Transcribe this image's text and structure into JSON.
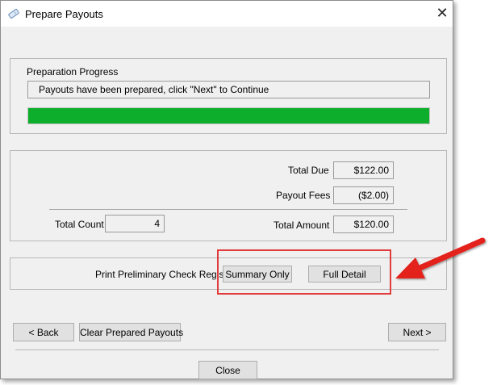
{
  "window": {
    "title": "Prepare Payouts",
    "app_icon": "ticket-icon",
    "close_icon": "close-icon"
  },
  "progress": {
    "group_label": "Preparation Progress",
    "status_text": "Payouts have been prepared, click \"Next\" to Continue",
    "bar_color": "#0cae2c",
    "percent": 100
  },
  "totals": {
    "total_due_label": "Total Due",
    "total_due_value": "$122.00",
    "payout_fees_label": "Payout Fees",
    "payout_fees_value": "($2.00)",
    "total_count_label": "Total Count",
    "total_count_value": "4",
    "total_amount_label": "Total Amount",
    "total_amount_value": "$120.00"
  },
  "print_register": {
    "label": "Print Preliminary Check Register",
    "summary_only_label": "Summary Only",
    "full_detail_label": "Full Detail",
    "highlight_color": "#e23b3b"
  },
  "nav": {
    "back_label": "< Back",
    "clear_label": "Clear Prepared Payouts",
    "next_label": "Next >",
    "close_label": "Close"
  }
}
